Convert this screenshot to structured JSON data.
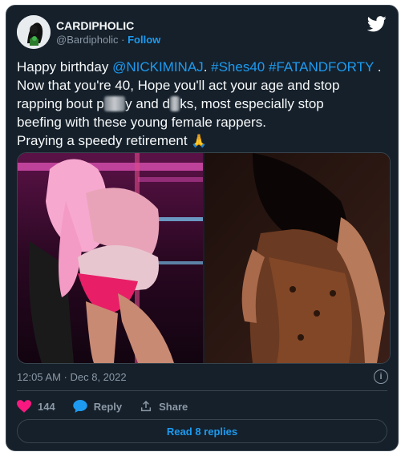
{
  "author": {
    "display_name": "CARDIPHOLIC",
    "handle": "@Bardipholic",
    "separator": "·",
    "follow_label": "Follow"
  },
  "tweet": {
    "line1_prefix": "Happy birthday ",
    "mention": "@NICKIMINAJ",
    "line1_mid": ". ",
    "hashtag1": "#Shes40",
    "hashtag2": "#FATANDFORTY",
    "line1_suffix": " .",
    "line2": "Now that you're 40, Hope you'll act your age and stop",
    "line3_a": "rapping bout  p",
    "blur1": "uss",
    "line3_b": "y and d",
    "blur2": "ic",
    "line3_c": "ks, most especially stop",
    "line4": "beefing with these young female rappers.",
    "line5": "Praying a speedy retirement ",
    "emoji": "🙏"
  },
  "timestamp": "12:05 AM · Dec 8, 2022",
  "info_glyph": "i",
  "actions": {
    "like_count": "144",
    "reply_label": "Reply",
    "share_label": "Share"
  },
  "read_replies_label": "Read 8 replies",
  "colors": {
    "background": "#15202b",
    "accent": "#1d9bf0",
    "like": "#f91880",
    "muted": "#8b98a5"
  }
}
